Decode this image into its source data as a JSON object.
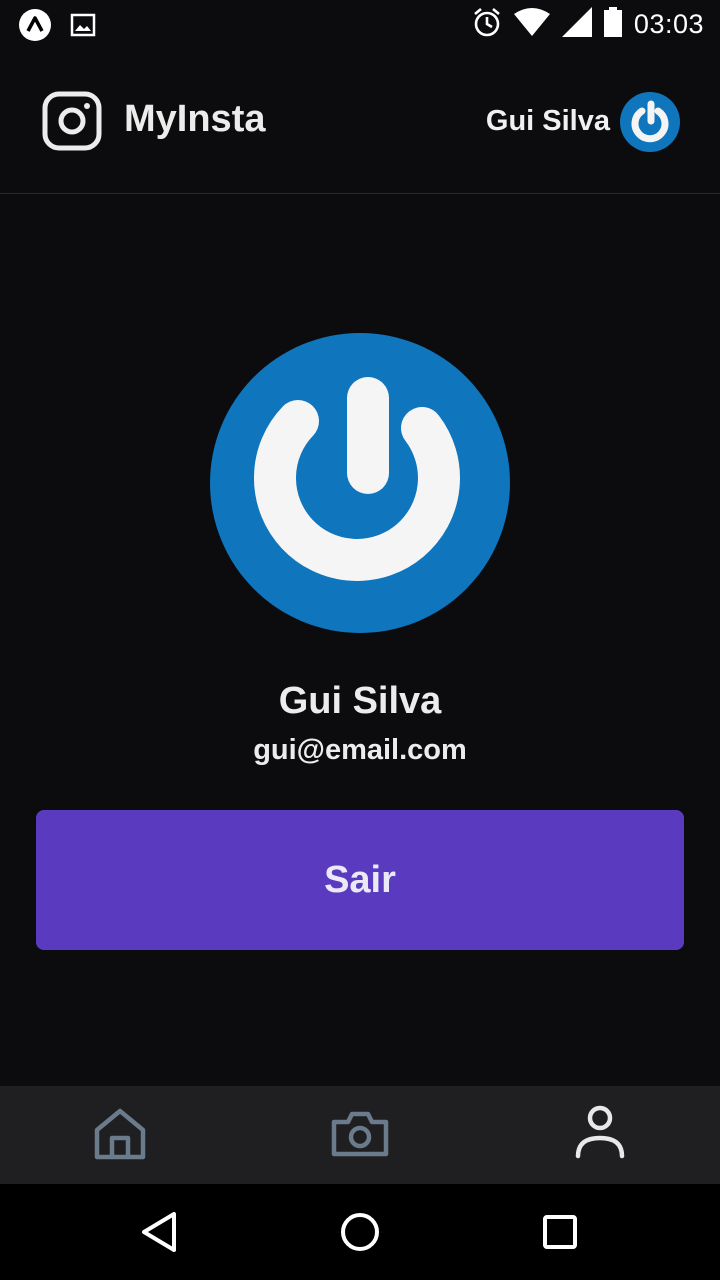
{
  "status_bar": {
    "time": "03:03",
    "icons": [
      "expo-icon",
      "image-icon",
      "alarm-icon",
      "wifi-icon",
      "signal-icon",
      "battery-icon"
    ]
  },
  "header": {
    "app_title": "MyInsta",
    "user_name": "Gui Silva",
    "logo_icon": "instagram-icon"
  },
  "profile": {
    "name": "Gui Silva",
    "email": "gui@email.com"
  },
  "actions": {
    "logout_label": "Sair"
  },
  "tab_bar": {
    "items": [
      {
        "icon": "home-icon",
        "active": false
      },
      {
        "icon": "camera-icon",
        "active": false
      },
      {
        "icon": "user-icon",
        "active": true
      }
    ]
  },
  "nav_bar": {
    "icons": [
      "back-triangle-icon",
      "home-circle-icon",
      "recent-square-icon"
    ]
  },
  "colors": {
    "background": "#0c0c0f",
    "accent": "#5a3bc0",
    "avatar_blue": "#0f75bc",
    "tab_inactive": "#6b7b8c",
    "tab_active": "#e8e8e8"
  }
}
